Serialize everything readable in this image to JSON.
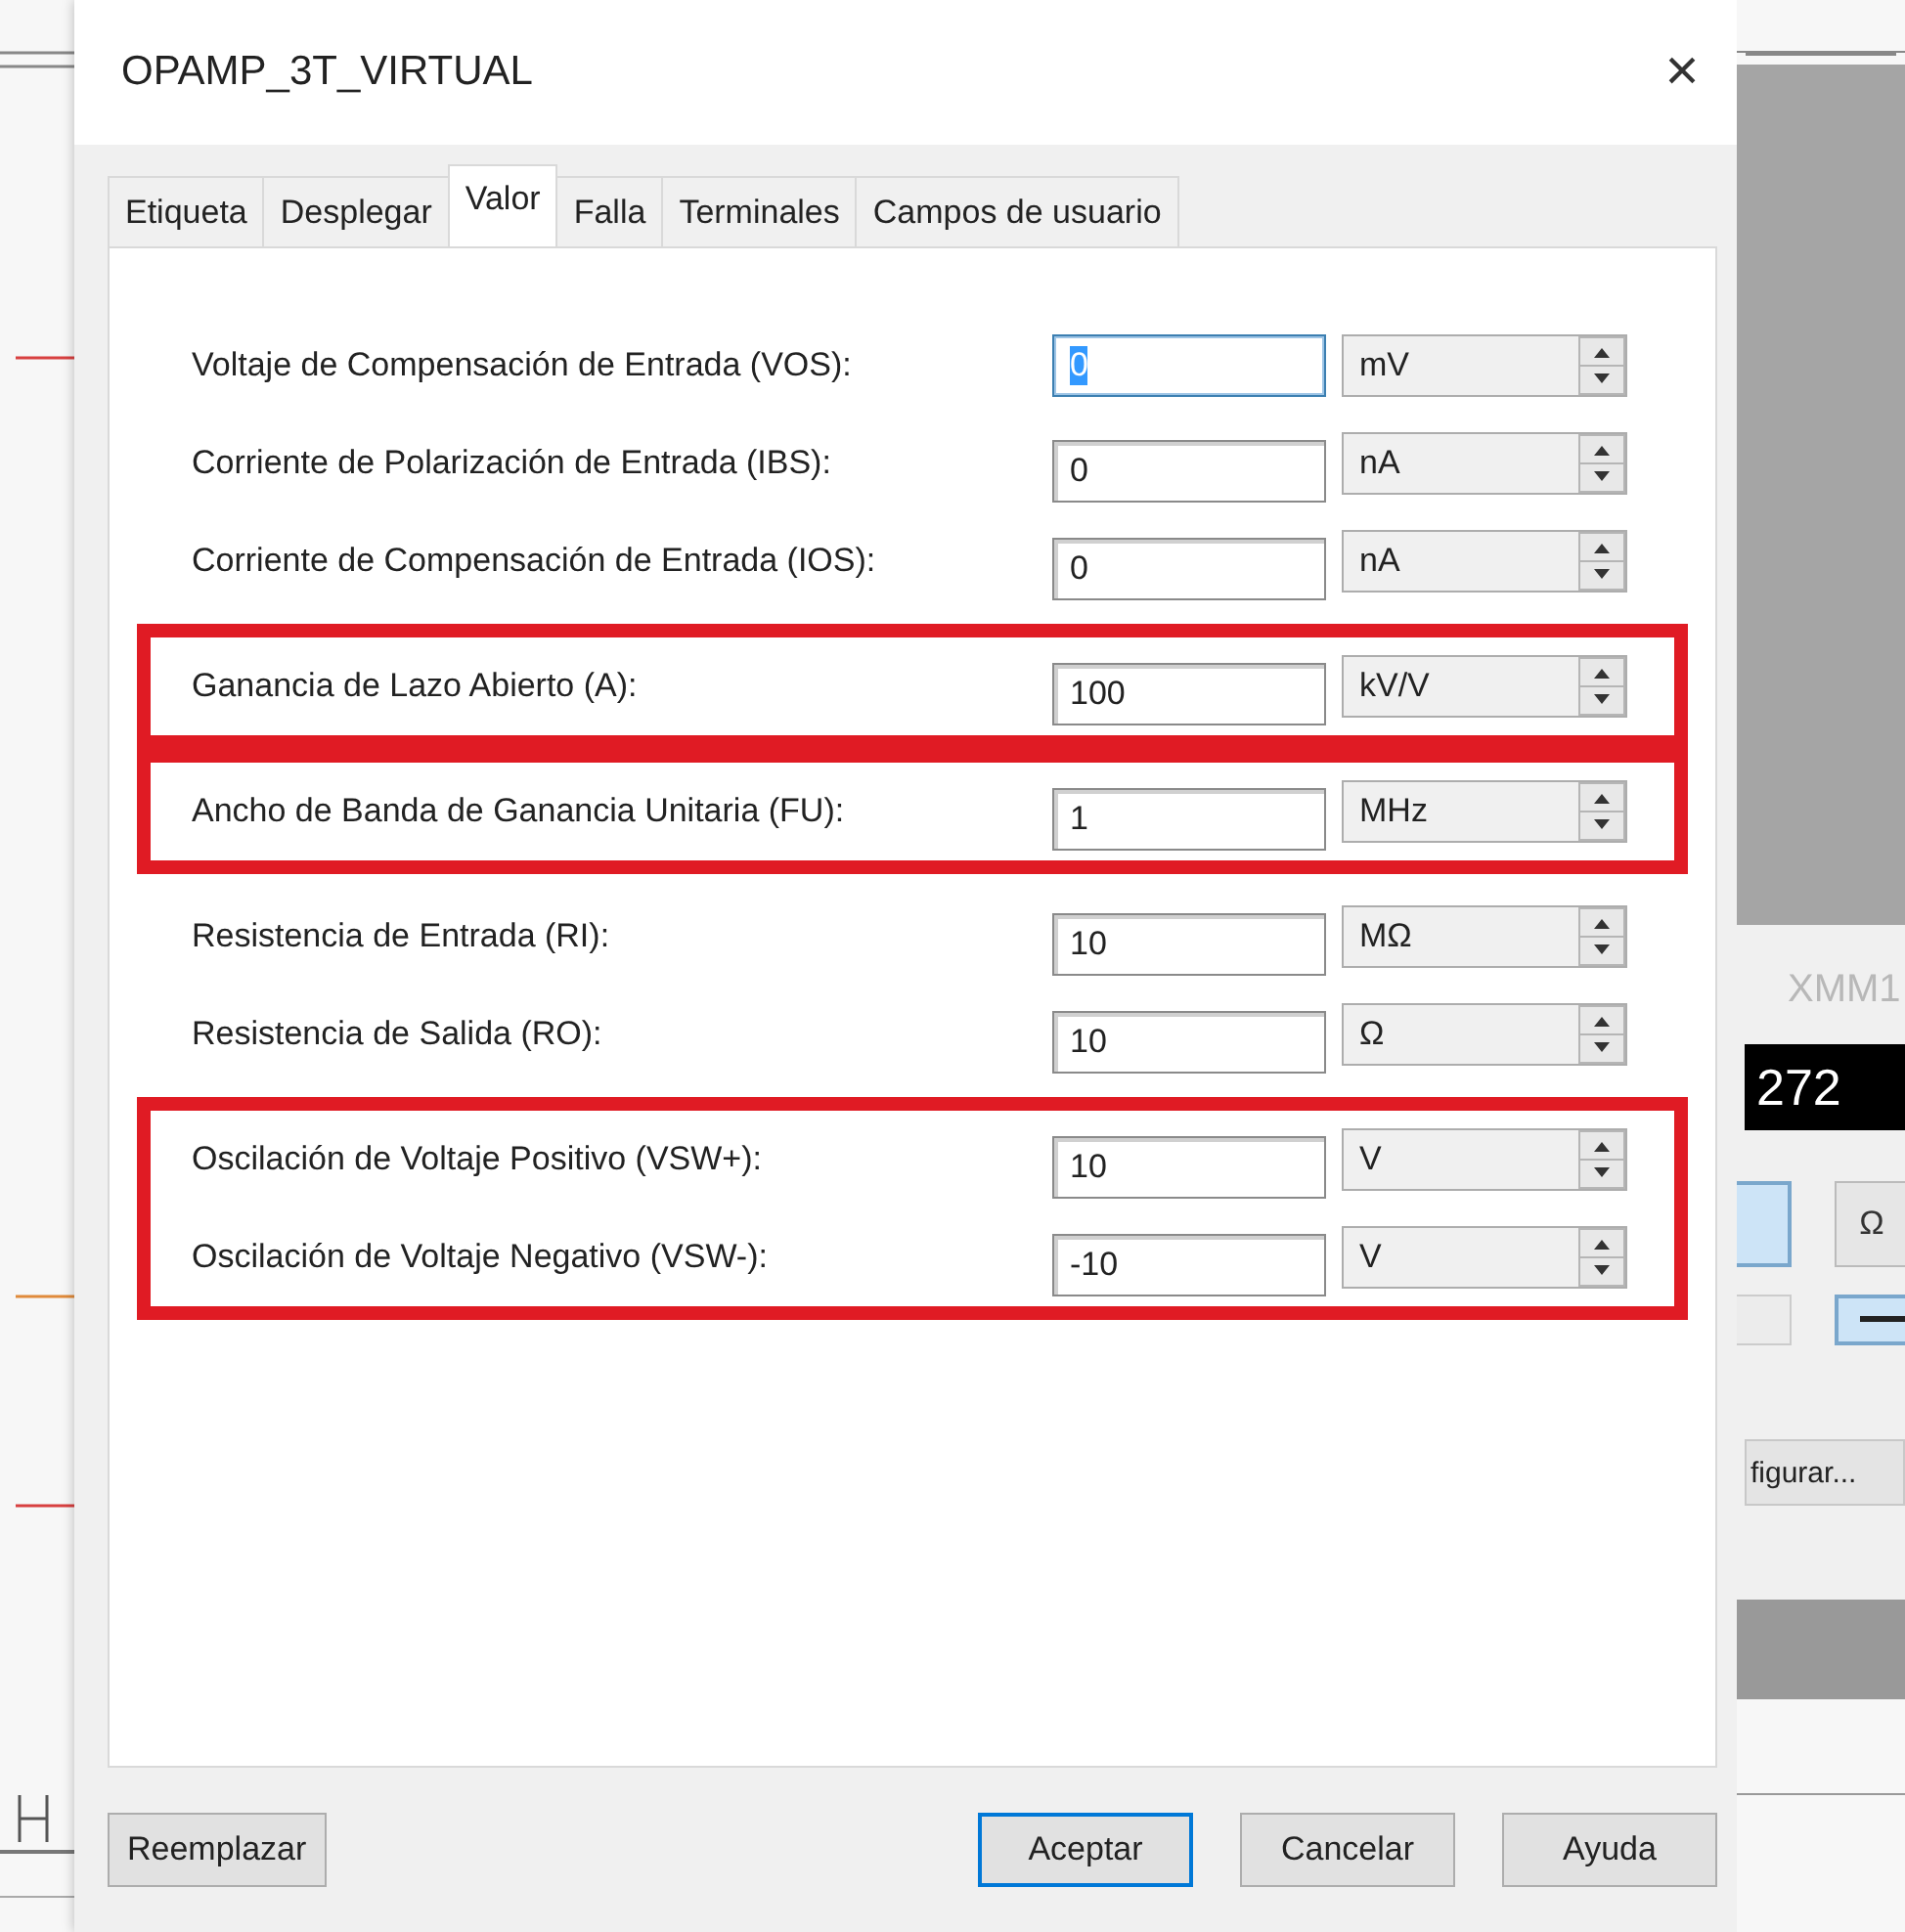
{
  "dialog": {
    "title": "OPAMP_3T_VIRTUAL",
    "close": "×"
  },
  "tabs": [
    {
      "label": "Etiqueta",
      "selected": false
    },
    {
      "label": "Desplegar",
      "selected": false
    },
    {
      "label": "Valor",
      "selected": true
    },
    {
      "label": "Falla",
      "selected": false
    },
    {
      "label": "Terminales",
      "selected": false
    },
    {
      "label": "Campos de usuario",
      "selected": false
    }
  ],
  "parameter_groups": [
    {
      "highlighted": false,
      "rows": [
        {
          "label": "Voltaje de Compensación de Entrada (VOS):",
          "value": "0",
          "unit": "mV",
          "focused": true
        },
        {
          "label": "Corriente de Polarización de Entrada (IBS):",
          "value": "0",
          "unit": "nA",
          "focused": false
        },
        {
          "label": "Corriente de Compensación de Entrada (IOS):",
          "value": "0",
          "unit": "nA",
          "focused": false
        }
      ]
    },
    {
      "highlighted": true,
      "rows": [
        {
          "label": "Ganancia de Lazo Abierto (A):",
          "value": "100",
          "unit": "kV/V",
          "focused": false
        }
      ]
    },
    {
      "highlighted": true,
      "rows": [
        {
          "label": "Ancho de Banda de Ganancia Unitaria (FU):",
          "value": "1",
          "unit": "MHz",
          "focused": false
        }
      ]
    },
    {
      "highlighted": false,
      "rows": [
        {
          "label": "Resistencia de Entrada (RI):",
          "value": "10",
          "unit": "MΩ",
          "focused": false
        },
        {
          "label": "Resistencia de Salida (RO):",
          "value": "10",
          "unit": "Ω",
          "focused": false
        }
      ]
    },
    {
      "highlighted": true,
      "rows": [
        {
          "label": "Oscilación de Voltaje Positivo (VSW+):",
          "value": "10",
          "unit": "V",
          "focused": false
        },
        {
          "label": "Oscilación de Voltaje Negativo (VSW-):",
          "value": "-10",
          "unit": "V",
          "focused": false
        }
      ]
    }
  ],
  "buttons": [
    {
      "label": "Reemplazar",
      "default": false
    },
    {
      "label": "Aceptar",
      "default": true
    },
    {
      "label": "Cancelar",
      "default": false
    },
    {
      "label": "Ayuda",
      "default": false
    }
  ],
  "meter": {
    "title": "XMM1",
    "reading": "272",
    "function_buttons": [
      {
        "kind": "blank",
        "selected": true
      },
      {
        "kind": "text",
        "label": "Ω",
        "selected": false
      }
    ],
    "signal_buttons": [
      {
        "kind": "blank",
        "selected": false
      },
      {
        "kind": "dc",
        "selected": true
      }
    ],
    "settings_button": "figurar..."
  }
}
